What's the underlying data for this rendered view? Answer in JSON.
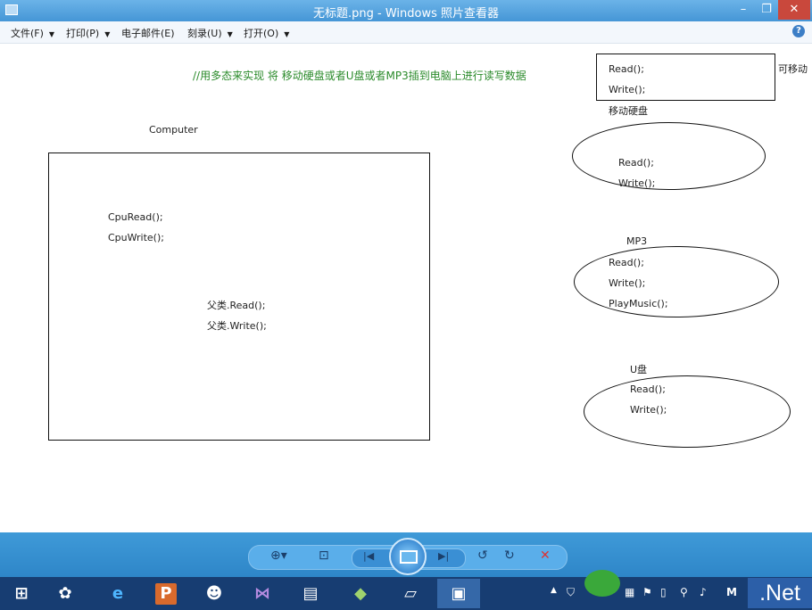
{
  "window": {
    "title": "无标题.png - Windows 照片查看器",
    "minimize": "–",
    "maximize": "❐",
    "close": "✕"
  },
  "menu": [
    {
      "label": "文件(F)"
    },
    {
      "label": "打印(P)"
    },
    {
      "label": "电子邮件(E)"
    },
    {
      "label": "刻录(U)"
    },
    {
      "label": "打开(O)"
    }
  ],
  "help": "?",
  "image": {
    "comment": "//用多态来实现 将 移动硬盘或者U盘或者MP3插到电脑上进行读写数据",
    "computer_label": "Computer",
    "cpu_read": "CpuRead();",
    "cpu_write": "CpuWrite();",
    "parent_read": "父类.Read();",
    "parent_write": "父类.Write();",
    "base_read": "Read();",
    "base_write": "Write();",
    "base_side": "可移动",
    "disk_label": "移动硬盘",
    "disk_read": "Read();",
    "disk_write": "Write();",
    "mp3_label": "MP3",
    "mp3_read": "Read();",
    "mp3_write": "Write();",
    "mp3_play": "PlayMusic();",
    "udisk_label": "U盘",
    "udisk_read": "Read();",
    "udisk_write": "Write();"
  },
  "viewer_controls": {
    "zoom": "⊕▾",
    "actual_size": "⊡",
    "prev": "|◀",
    "next": "▶|",
    "rotate_ccw": "↺",
    "rotate_cw": "↻",
    "delete": "✕"
  },
  "taskbar": {
    "apps": [
      "Windows",
      "Pinwheel",
      "Internet Explorer",
      "PowerPoint",
      "Users",
      "Visual Studio",
      "Document",
      "Tool",
      "Files",
      "Photo Viewer"
    ],
    "tray_m": "M",
    "brand": ".Net"
  }
}
